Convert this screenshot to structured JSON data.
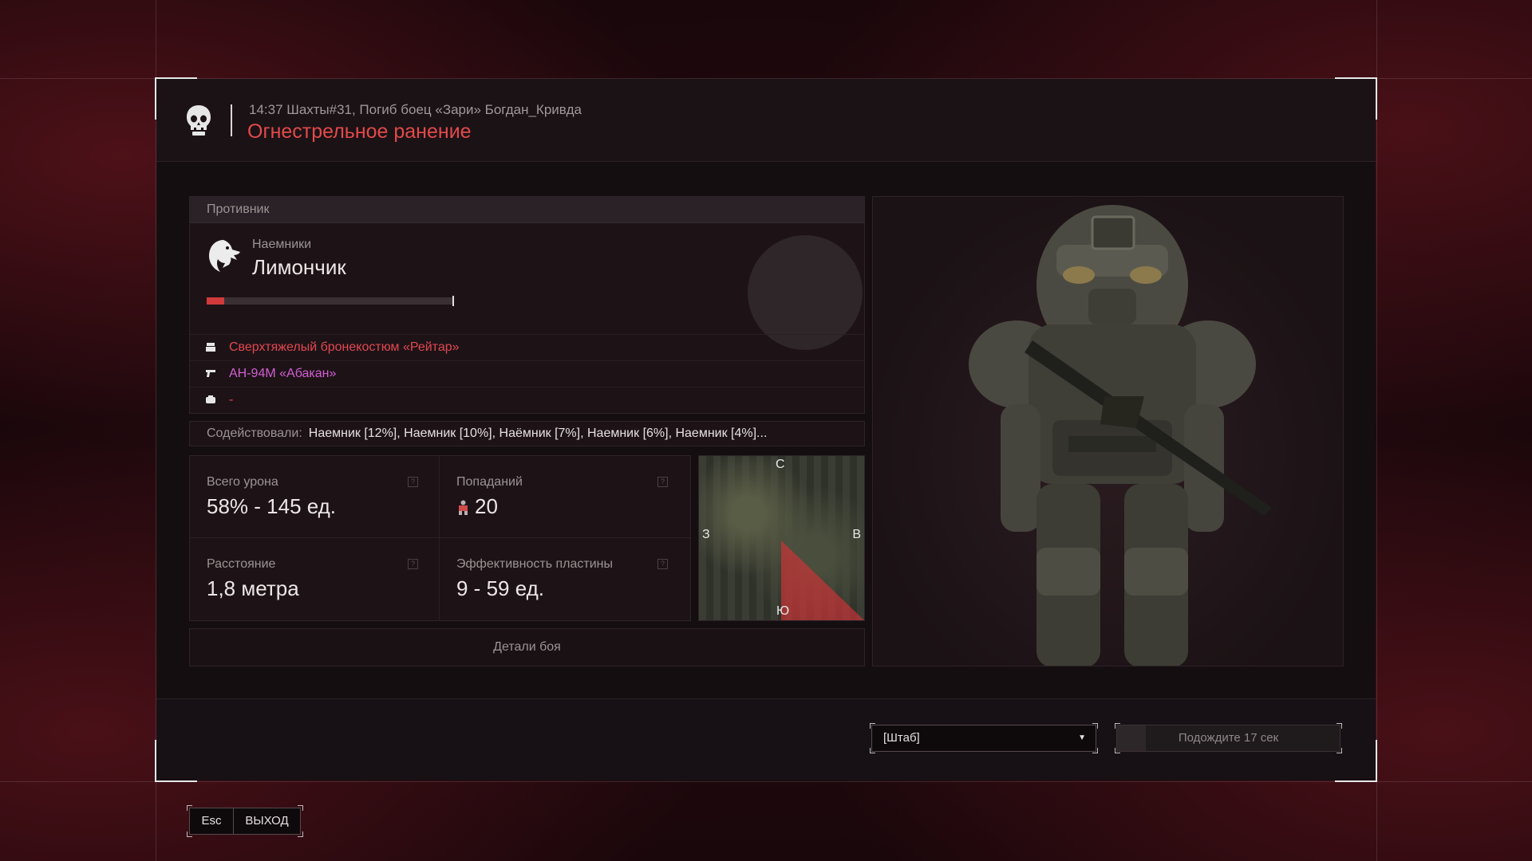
{
  "header": {
    "subtitle": "14:37 Шахты#31, Погиб боец «Зари» Богдан_Кривда",
    "title": "Огнестрельное ранение",
    "title_color": "#e24a4a"
  },
  "enemy": {
    "section_label": "Противник",
    "faction": "Наемники",
    "name": "Лимончик",
    "health_fraction": 0.07,
    "equipment": {
      "armor": "Сверхтяжелый бронекостюм «Рейтар»",
      "weapon": "АН-94М «Абакан»",
      "extra": "-"
    }
  },
  "assist": {
    "label": "Содействовали:",
    "text": "Наемник [12%], Наемник [10%], Наёмник [7%], Наемник [6%], Наемник [4%]..."
  },
  "stats": {
    "total_damage": {
      "label": "Всего урона",
      "value": "58% - 145 ед."
    },
    "hits": {
      "label": "Попаданий",
      "value": "20"
    },
    "distance": {
      "label": "Расстояние",
      "value": "1,8 метра"
    },
    "plate": {
      "label": "Эффективность пластины",
      "value": "9 - 59 ед."
    }
  },
  "minimap": {
    "north": "С",
    "west": "З",
    "east": "В",
    "south": "Ю"
  },
  "details_button": "Детали боя",
  "footer": {
    "respawn_select": "[Штаб]",
    "wait_button": "Подождите 17 сек",
    "wait_progress": 0.13
  },
  "esc": {
    "key": "Esc",
    "label": "ВЫХОД"
  },
  "icons": {
    "skull": "skull-icon",
    "eagle": "eagle-icon",
    "armor": "armor-icon",
    "weapon": "rifle-icon",
    "extra": "device-icon",
    "hit": "body-hit-icon"
  }
}
